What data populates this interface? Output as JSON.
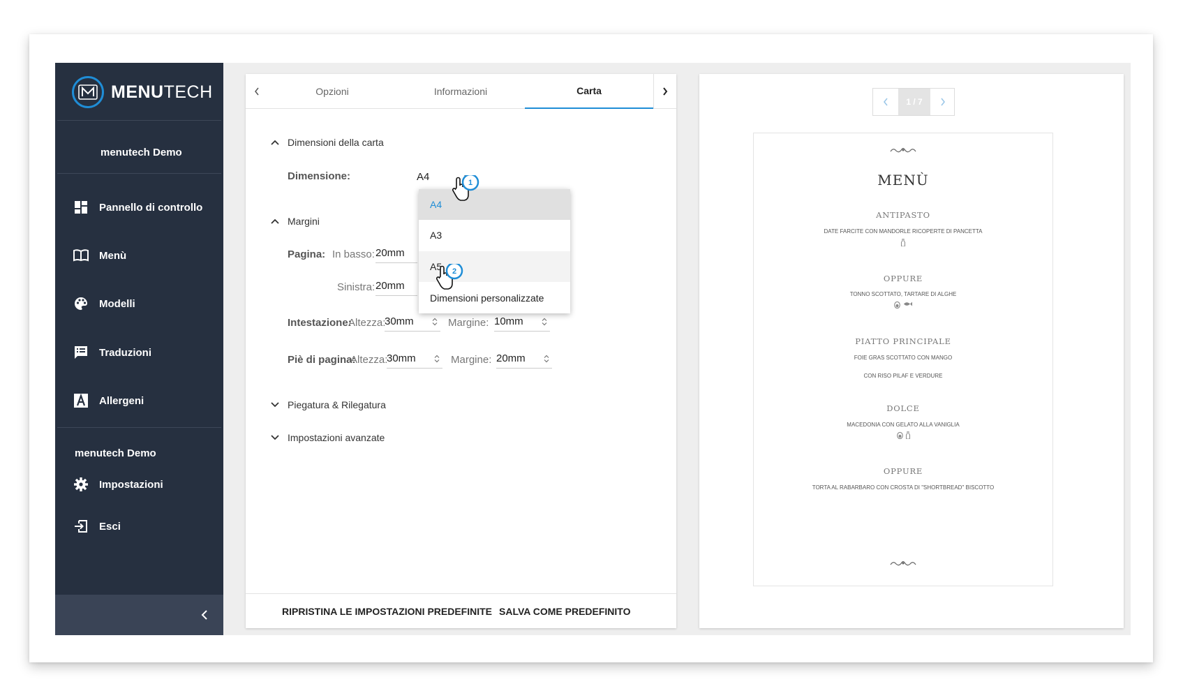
{
  "brand": {
    "bold": "MENU",
    "light": "TECH"
  },
  "sidebar": {
    "user": "menutech Demo",
    "items": [
      {
        "label": "Pannello di controllo",
        "icon": "dashboard-icon"
      },
      {
        "label": "Menù",
        "icon": "book-icon"
      },
      {
        "label": "Modelli",
        "icon": "palette-icon"
      },
      {
        "label": "Traduzioni",
        "icon": "translate-icon"
      },
      {
        "label": "Allergeni",
        "icon": "allergen-icon"
      }
    ],
    "section": "menutech Demo",
    "settings": "Impostazioni",
    "logout": "Esci"
  },
  "tabs": [
    {
      "label": "Opzioni",
      "active": false
    },
    {
      "label": "Informazioni",
      "active": false
    },
    {
      "label": "Carta",
      "active": true
    }
  ],
  "form": {
    "paper_section": "Dimensioni della carta",
    "size_label": "Dimensione:",
    "size_value": "A4",
    "margins_section": "Margini",
    "page_label": "Pagina:",
    "bottom_label": "In basso:",
    "bottom_value": "20mm",
    "left_label": "Sinistra:",
    "left_value": "20mm",
    "header_label": "Intestazione:",
    "header_height_label": "Altezza:",
    "header_height_value": "30mm",
    "header_margin_label": "Margine:",
    "header_margin_value": "10mm",
    "footer_label": "Piè di pagina:",
    "footer_height_label": "Altezza:",
    "footer_height_value": "30mm",
    "footer_margin_label": "Margine:",
    "footer_margin_value": "20mm",
    "folding_section": "Piegatura & Rilegatura",
    "advanced_section": "Impostazioni avanzate"
  },
  "dropdown": {
    "options": [
      "A4",
      "A3",
      "A5",
      "Dimensioni personalizzate"
    ],
    "selected": "A4",
    "hovered": "A5"
  },
  "footer": {
    "reset": "RIPRISTINA LE IMPOSTAZIONI PREDEFINITE",
    "save": "SALVA COME PREDEFINITO"
  },
  "callouts": [
    "1",
    "2"
  ],
  "preview": {
    "pager": "1 / 7",
    "title": "MENÙ",
    "courses": [
      {
        "name": "ANTIPASTO",
        "dishes": [
          "DATE FARCITE CON MANDORLE RICOPERTE DI PANCETTA"
        ]
      },
      {
        "name": "OPPURE",
        "dishes": [
          "TONNO SCOTTATO, TARTARE DI ALGHE"
        ]
      },
      {
        "name": "PIATTO PRINCIPALE",
        "dishes": [
          "FOIE GRAS SCOTTATO CON MANGO",
          "CON RISO PILAF E VERDURE"
        ]
      },
      {
        "name": "DOLCE",
        "dishes": [
          "MACEDONIA CON GELATO ALLA VANIGLIA"
        ]
      },
      {
        "name": "OPPURE",
        "dishes": [
          "TORTA AL RABARBARO CON CROSTA DI \"SHORTBREAD\" BISCOTTO"
        ]
      }
    ]
  },
  "colors": {
    "sidebar": "#263040",
    "accent": "#1f8dd6",
    "background": "#eeeeee"
  }
}
